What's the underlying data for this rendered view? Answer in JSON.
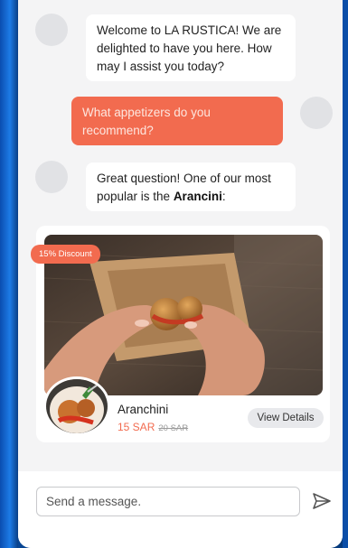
{
  "chat": {
    "messages": [
      {
        "sender": "bot",
        "text": "Welcome to LA RUSTICA! We are delighted to have you here. How may I assist you today?"
      },
      {
        "sender": "user",
        "text": "What appetizers do you recommend?"
      },
      {
        "sender": "bot",
        "text_before": "Great question! One of our most popular is the ",
        "highlight": "Arancini",
        "text_after": ":"
      }
    ]
  },
  "product": {
    "badge": "15% Discount",
    "name": "Aranchini",
    "price": "15 SAR",
    "old_price": "20 SAR",
    "details_label": "View Details"
  },
  "composer": {
    "placeholder": "Send a message."
  },
  "colors": {
    "accent": "#f26b4f",
    "panel": "#f4f4f5",
    "bubble_bot": "#ffffff",
    "desktop": "#0d5fc4"
  },
  "icons": {
    "send": "send-icon",
    "avatar": "avatar-placeholder"
  }
}
